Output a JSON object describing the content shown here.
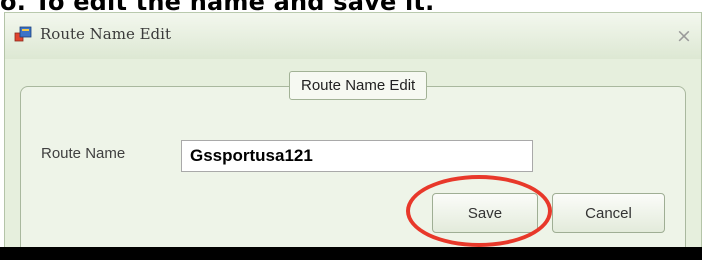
{
  "caption": {
    "text": "o. To edit the name and save it."
  },
  "window": {
    "title": "Route Name Edit",
    "close_glyph": "×"
  },
  "group": {
    "legend": "Route Name Edit"
  },
  "form": {
    "route_name_label": "Route Name",
    "route_name_value": "Gssportusa121"
  },
  "buttons": {
    "save_label": "Save",
    "cancel_label": "Cancel"
  },
  "colors": {
    "annotation": "#e8382a",
    "window_background": "#e6efdd",
    "icon_red": "#e0442f",
    "icon_blue": "#3b73c8"
  },
  "icons": {
    "app": "app-icon",
    "close": "close-icon"
  }
}
